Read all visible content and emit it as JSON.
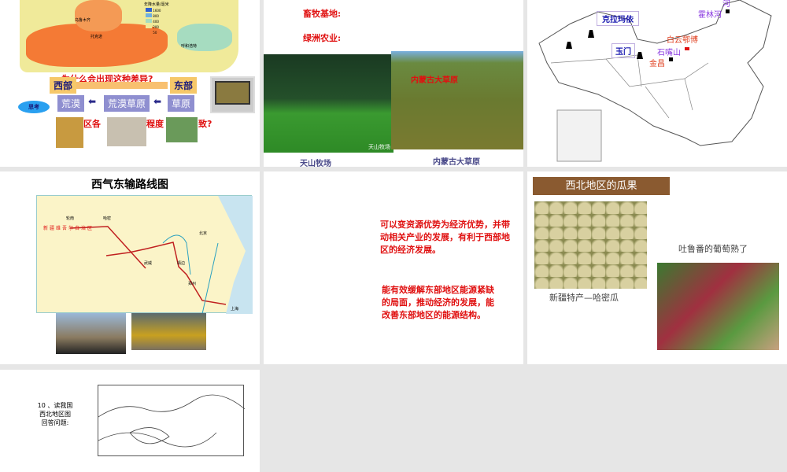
{
  "slide1": {
    "legend_title": "年降水量/毫米",
    "legend": [
      "1600",
      "800",
      "400",
      "200",
      "50"
    ],
    "cities": [
      "乌鲁木齐",
      "托克逊",
      "呼和浩特"
    ],
    "question1": "为什么会出现这种差异?",
    "west": "西部",
    "east": "东部",
    "zones": [
      "荒漠",
      "荒漠草原",
      "草原"
    ],
    "think": "思考",
    "question2": "区各",
    "question2b": "程度",
    "question2c": "致?"
  },
  "slide2": {
    "line1": "畜牧基地:",
    "line2": "绿洲农业:",
    "photo1_caption": "天山牧场",
    "photo1_inner": "天山牧场",
    "photo2_inner": "内蒙古大草原",
    "photo2_caption": "内蒙古大草原"
  },
  "slide3": {
    "labels": {
      "karamay": "克拉玛依",
      "yumen": "玉门",
      "baiyun": "白云鄂博",
      "shizuishan": "石嘴山",
      "jinchang": "金昌",
      "huolinhe": "霍林河",
      "he": "河"
    }
  },
  "slide4": {
    "title": "西气东输路线图",
    "region": "新疆维吾尔自治区",
    "cities": [
      "轮南",
      "哈密",
      "武威",
      "靖边",
      "北京",
      "郑州",
      "上海"
    ]
  },
  "slide5": {
    "para1": "可以变资源优势为经济优势，并带动相关产业的发展，有利于西部地区的经济发展。",
    "para2": "能有效缓解东部地区能源紧缺的局面，推动经济的发展，能改善东部地区的能源结构。"
  },
  "slide6": {
    "title": "西北地区的瓜果",
    "melon_caption": "新疆特产—哈密瓜",
    "grape_caption": "吐鲁番的葡萄熟了"
  },
  "slide7": {
    "line1": "10 、读我国",
    "line2": "西北地区图",
    "line3": "回答问题:"
  }
}
